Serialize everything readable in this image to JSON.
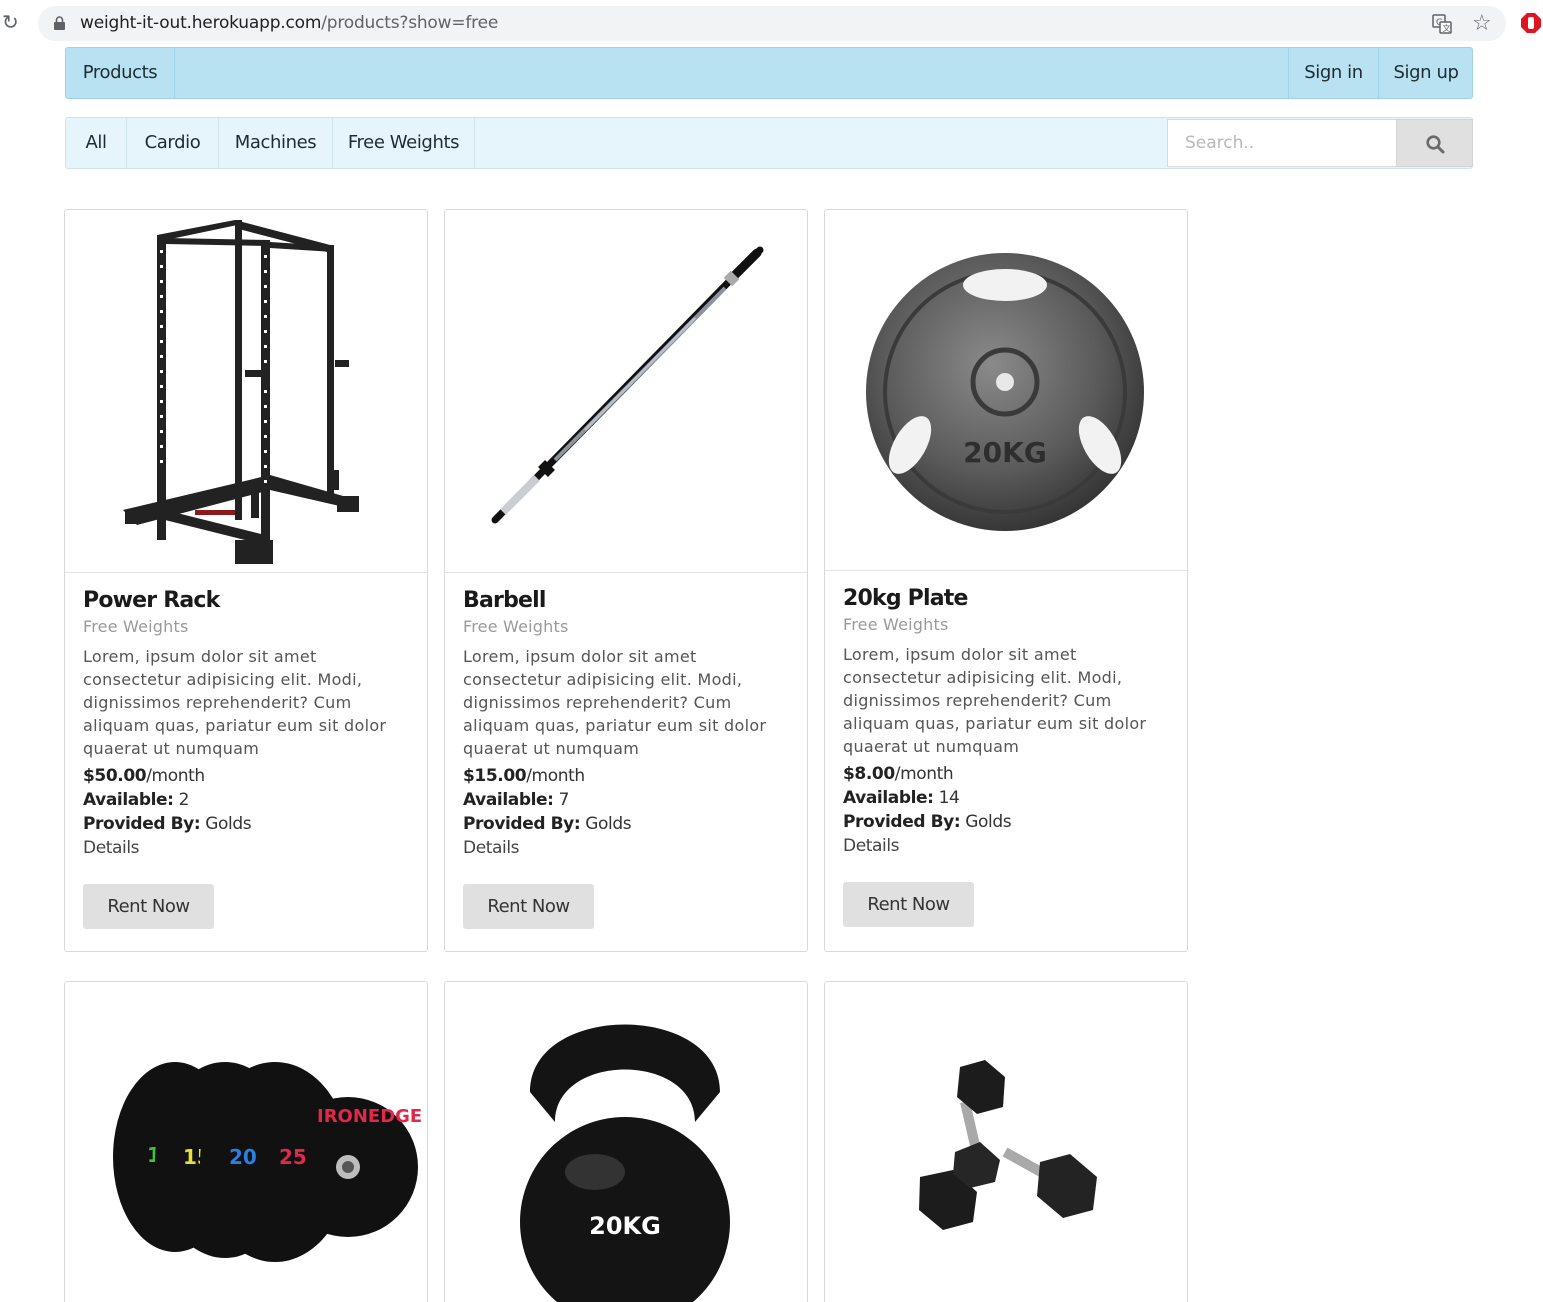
{
  "browser": {
    "url_host": "weight-it-out.herokuapp.com",
    "url_path": "/products?show=free"
  },
  "navbar": {
    "products": "Products",
    "sign_in": "Sign in",
    "sign_up": "Sign up"
  },
  "categories": {
    "all": "All",
    "cardio": "Cardio",
    "machines": "Machines",
    "free_weights": "Free Weights",
    "search_placeholder": "Search.."
  },
  "labels": {
    "per_month": "/month",
    "available": "Available:",
    "provided_by": "Provided By:",
    "details": "Details",
    "rent_now": "Rent Now"
  },
  "products": [
    {
      "name": "Power Rack",
      "category": "Free Weights",
      "description": "Lorem, ipsum dolor sit amet consectetur adipisicing elit. Modi, dignissimos reprehenderit? Cum aliquam quas, pariatur eum sit dolor quaerat ut numquam",
      "price": "$50.00",
      "available": "2",
      "provider": "Golds",
      "image": "power-rack-image"
    },
    {
      "name": "Barbell",
      "category": "Free Weights",
      "description": "Lorem, ipsum dolor sit amet consectetur adipisicing elit. Modi, dignissimos reprehenderit? Cum aliquam quas, pariatur eum sit dolor quaerat ut numquam",
      "price": "$15.00",
      "available": "7",
      "provider": "Golds",
      "image": "barbell-image"
    },
    {
      "name": "20kg Plate",
      "category": "Free Weights",
      "description": "Lorem, ipsum dolor sit amet consectetur adipisicing elit. Modi, dignissimos reprehenderit? Cum aliquam quas, pariatur eum sit dolor quaerat ut numquam",
      "price": "$8.00",
      "available": "14",
      "provider": "Golds",
      "image": "weight-plate-image",
      "image_text": "20KG"
    },
    {
      "image": "bumper-plates-image",
      "image_text": "IRONEDGE"
    },
    {
      "image": "kettlebell-image",
      "image_text": "20KG"
    },
    {
      "image": "dumbbells-image"
    }
  ]
}
